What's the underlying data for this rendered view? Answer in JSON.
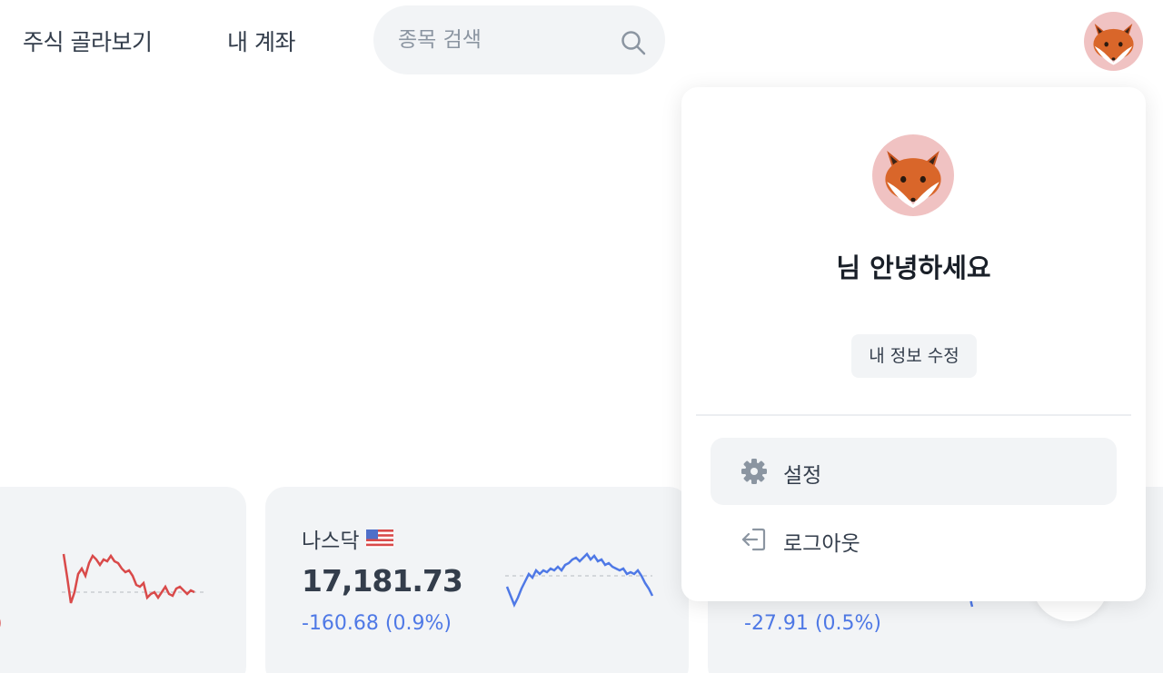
{
  "nav": {
    "links": [
      "주식 골라보기",
      "내 계좌"
    ],
    "search_placeholder": "종목 검색"
  },
  "cards": [
    {
      "change": ")",
      "change_color": "#d94a4a"
    },
    {
      "name": "나스닥",
      "value": "17,181.73",
      "change": "-160.68 (0.9%)",
      "change_color": "#4f79e6"
    },
    {
      "change": "-27.91 (0.5%)",
      "change_color": "#4f79e6"
    }
  ],
  "profile_menu": {
    "greeting": "님 안녕하세요",
    "edit_label": "내 정보 수정",
    "items": [
      {
        "label": "설정",
        "icon": "gear-icon"
      },
      {
        "label": "로그아웃",
        "icon": "logout-icon"
      }
    ]
  },
  "colors": {
    "up": "#d94a4a",
    "down": "#4f79e6",
    "avatar_bg": "#f0c2c2",
    "card_bg": "#f2f4f6"
  }
}
